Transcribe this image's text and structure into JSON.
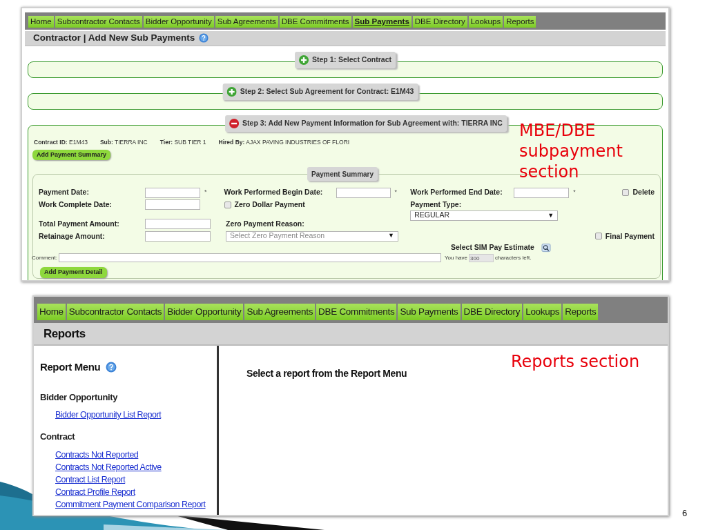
{
  "slide": {
    "page_number": "6"
  },
  "annotations": [
    {
      "text": "MBE/DBE subpayment section"
    },
    {
      "text": "Reports section"
    }
  ],
  "sub_payments_screen": {
    "tabs": [
      {
        "label": "Home",
        "selected": false
      },
      {
        "label": "Subcontractor Contacts",
        "selected": false
      },
      {
        "label": "Bidder Opportunity",
        "selected": false
      },
      {
        "label": "Sub Agreements",
        "selected": false
      },
      {
        "label": "DBE Commitments",
        "selected": false
      },
      {
        "label": "Sub Payments",
        "selected": true
      },
      {
        "label": "DBE Directory",
        "selected": false
      },
      {
        "label": "Lookups",
        "selected": false
      },
      {
        "label": "Reports",
        "selected": false
      }
    ],
    "title": "Contractor | Add New Sub Payments",
    "steps": [
      {
        "label": "Step 1: Select Contract",
        "expanded": false
      },
      {
        "label": "Step 2: Select Sub Agreement for Contract: E1M43",
        "expanded": false
      },
      {
        "label": "Step 3: Add New Payment Information for Sub Agreement with: TIERRA INC",
        "expanded": true
      }
    ],
    "info": [
      {
        "label": "Contract ID:",
        "value": "E1M43"
      },
      {
        "label": "Sub:",
        "value": "TIERRA INC"
      },
      {
        "label": "Tier:",
        "value": "SUB TIER 1"
      },
      {
        "label": "Hired By:",
        "value": "AJAX PAVING INDUSTRIES OF FLORI"
      }
    ],
    "add_summary_button": "Add Payment Summary",
    "payment_summary": {
      "legend": "Payment Summary",
      "payment_date": {
        "label": "Payment Date:",
        "mark": "*"
      },
      "work_complete_date": {
        "label": "Work Complete Date:"
      },
      "begin_date": {
        "label": "Work Performed Begin Date:",
        "mark": "*"
      },
      "zero_dollar": {
        "label": "Zero Dollar Payment",
        "checked": false
      },
      "end_date": {
        "label": "Work Performed End Date:",
        "mark": "*"
      },
      "payment_type": {
        "label": "Payment Type:",
        "value": "REGULAR",
        "arrow": "▼"
      },
      "delete": {
        "label": "Delete",
        "checked": false
      },
      "total_amount": {
        "label": "Total Payment Amount:"
      },
      "retainage": {
        "label": "Retainage Amount:"
      },
      "zero_reason": {
        "label": "Zero Payment Reason:",
        "placeholder": "Select Zero Payment Reason",
        "arrow": "▼"
      },
      "final_payment": {
        "label": "Final Payment",
        "checked": false
      },
      "sim_estimate": "Select SIM Pay Estimate",
      "comment": {
        "label": "Comment:",
        "before": "You have",
        "count": "300",
        "after": "characters left."
      },
      "add_detail_button": "Add Payment Detail"
    }
  },
  "reports_screen": {
    "tabs": [
      {
        "label": "Home",
        "selected": false
      },
      {
        "label": "Subcontractor Contacts",
        "selected": false
      },
      {
        "label": "Bidder Opportunity",
        "selected": false
      },
      {
        "label": "Sub Agreements",
        "selected": false
      },
      {
        "label": "DBE Commitments",
        "selected": false
      },
      {
        "label": "Sub Payments",
        "selected": false
      },
      {
        "label": "DBE Directory",
        "selected": false
      },
      {
        "label": "Lookups",
        "selected": false
      },
      {
        "label": "Reports",
        "selected": false
      }
    ],
    "title": "Reports",
    "menu_title": "Report Menu",
    "groups": [
      {
        "title": "Bidder Opportunity",
        "links": [
          "Bidder Opportunity List Report"
        ]
      },
      {
        "title": "Contract",
        "links": [
          "Contracts Not Reported",
          "Contracts Not Reported Active",
          "Contract List Report",
          "Contract Profile Report",
          "Commitment Payment Comparison Report"
        ]
      }
    ],
    "message": "Select a report from the Report Menu"
  }
}
